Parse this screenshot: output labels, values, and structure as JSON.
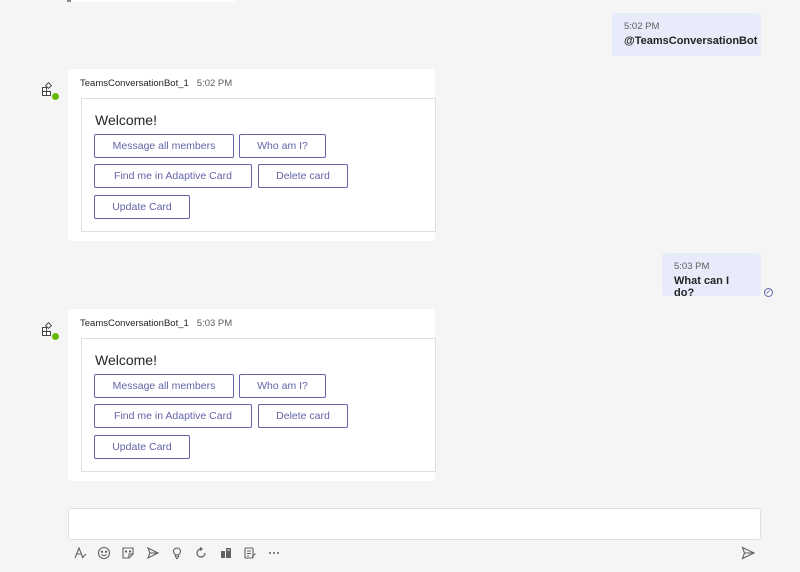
{
  "messages": {
    "out1": {
      "time": "5:02 PM",
      "text": "@TeamsConversationBot"
    },
    "bot1": {
      "sender": "TeamsConversationBot_1",
      "time": "5:02 PM",
      "card": {
        "title": "Welcome!",
        "buttons": [
          "Message all members",
          "Who am I?",
          "Find me in Adaptive Card",
          "Delete card",
          "Update Card"
        ]
      }
    },
    "out2": {
      "time": "5:03 PM",
      "text": "What can I do?"
    },
    "bot2": {
      "sender": "TeamsConversationBot_1",
      "time": "5:03 PM",
      "card": {
        "title": "Welcome!",
        "buttons": [
          "Message all members",
          "Who am I?",
          "Find me in Adaptive Card",
          "Delete card",
          "Update Card"
        ]
      }
    }
  },
  "composer": {
    "placeholder": "",
    "toolbar_icons": [
      "format-icon",
      "emoji-icon",
      "sticker-icon",
      "praise-icon",
      "idea-icon",
      "loop-icon",
      "approvals-icon",
      "forms-icon",
      "more-options-icon"
    ],
    "send_icon": "send-icon"
  },
  "colors": {
    "accent": "#6264a7",
    "outgoing_bg": "#e8ebfa",
    "status_green": "#6bb700",
    "background": "#f5f5f5"
  }
}
